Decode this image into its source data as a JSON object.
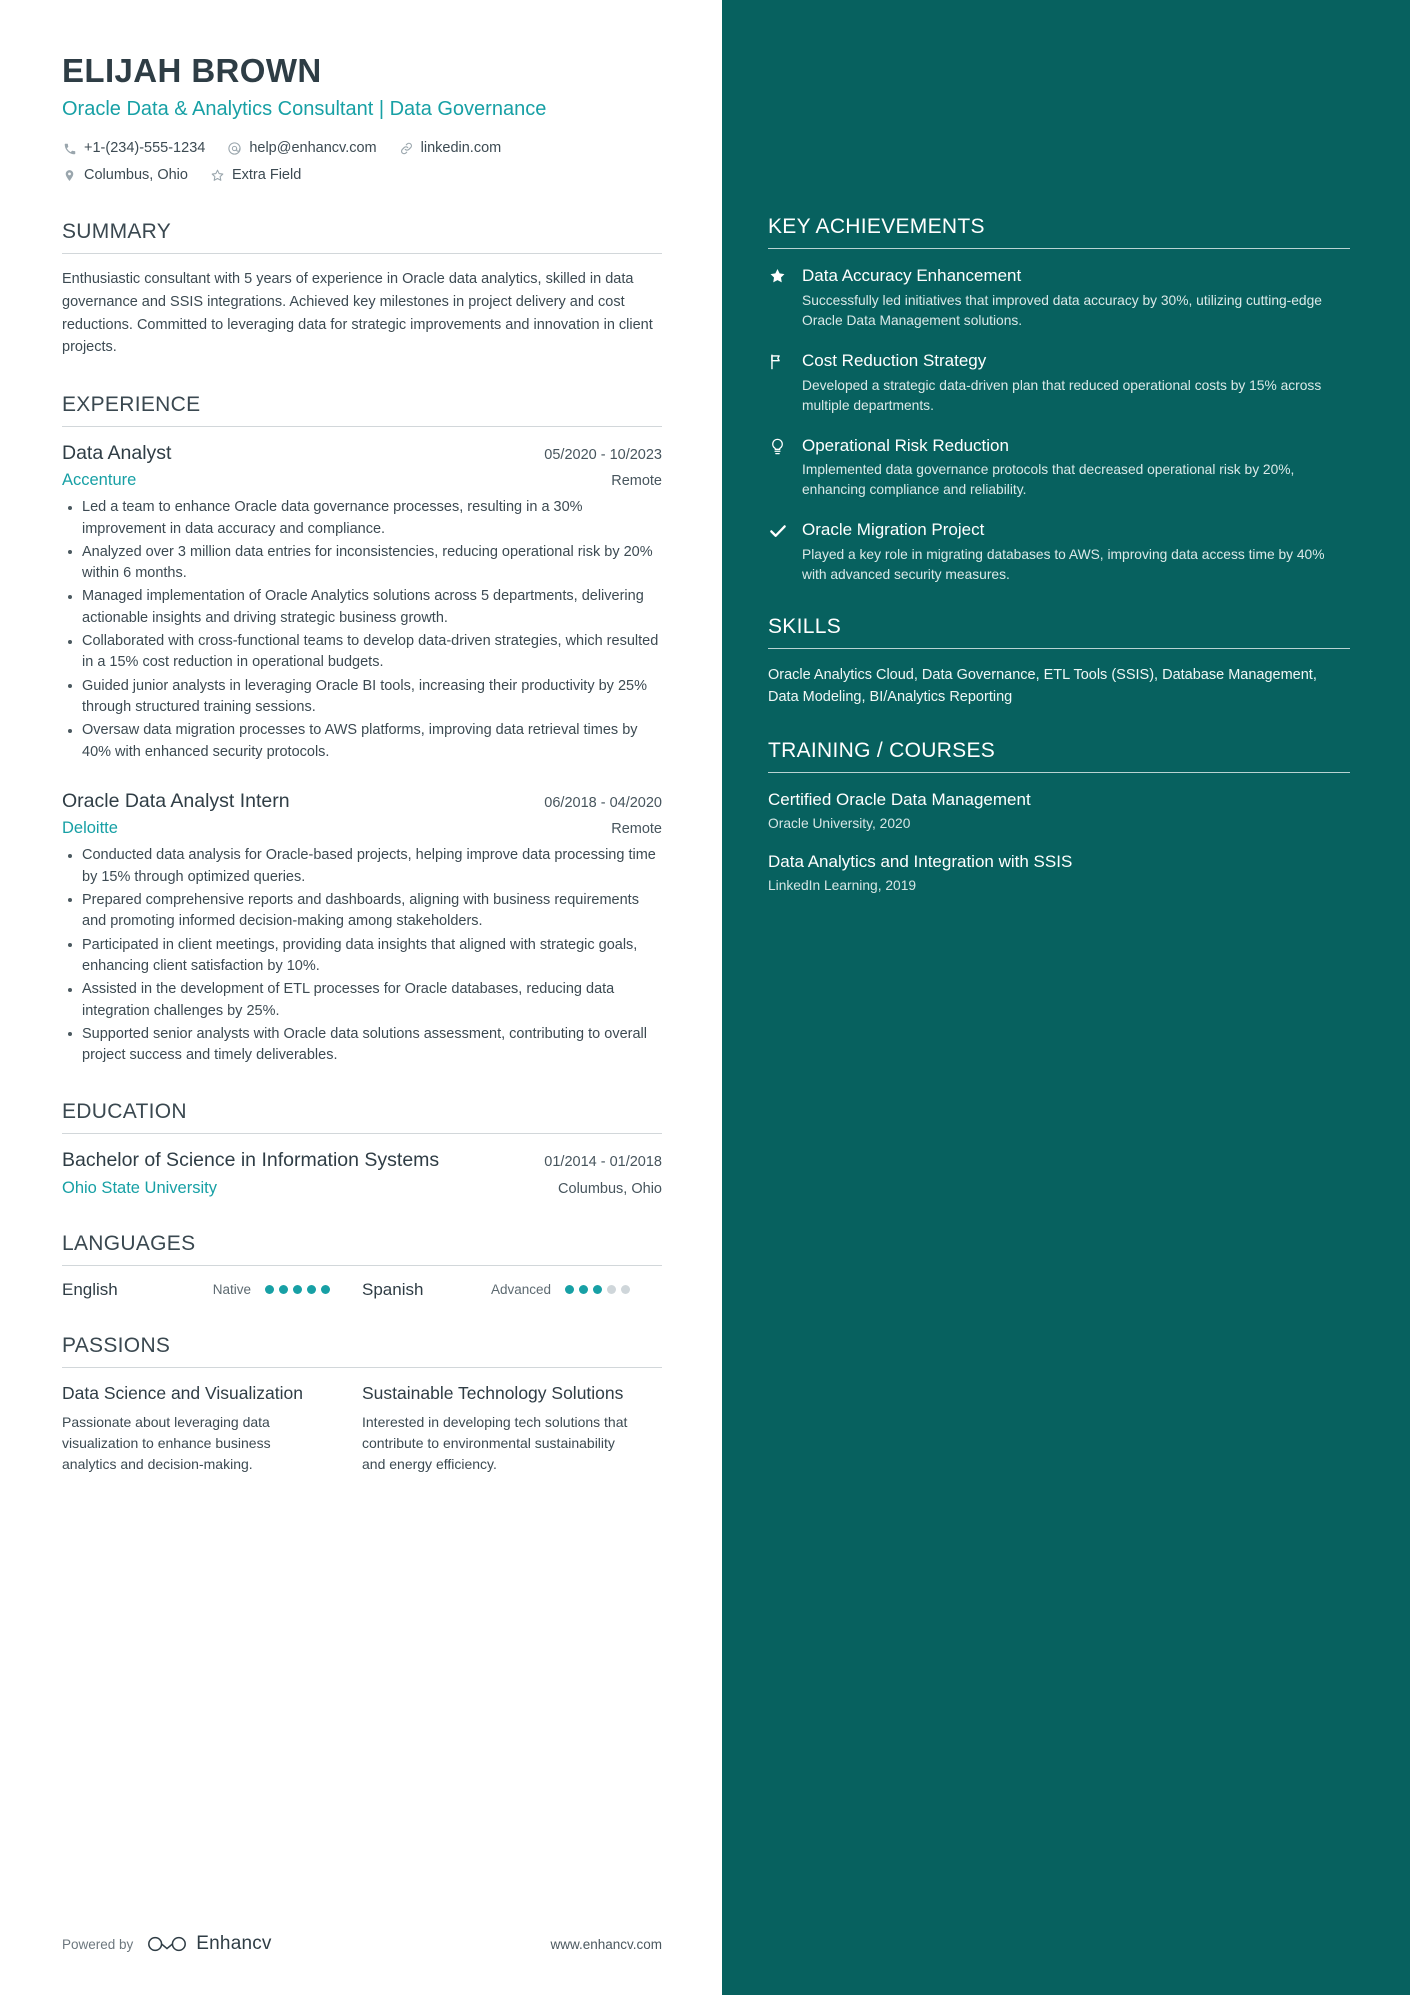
{
  "theme": {
    "accent": "#17a0a5",
    "sidebar_bg": "#07615f",
    "text": "#3c4a52"
  },
  "header": {
    "name": "ELIJAH BROWN",
    "headline": "Oracle Data & Analytics Consultant | Data Governance",
    "contacts_row1": [
      {
        "icon": "phone-icon",
        "text": "+1-(234)-555-1234"
      },
      {
        "icon": "at-email-icon",
        "text": "help@enhancv.com"
      },
      {
        "icon": "link-icon",
        "text": "linkedin.com"
      }
    ],
    "contacts_row2": [
      {
        "icon": "location-pin-icon",
        "text": "Columbus, Ohio"
      },
      {
        "icon": "star-outline-icon",
        "text": "Extra Field"
      }
    ]
  },
  "summary": {
    "title": "SUMMARY",
    "text": "Enthusiastic consultant with 5 years of experience in Oracle data analytics, skilled in data governance and SSIS integrations. Achieved key milestones in project delivery and cost reductions. Committed to leveraging data for strategic improvements and innovation in client projects."
  },
  "experience": {
    "title": "EXPERIENCE",
    "jobs": [
      {
        "title": "Data Analyst",
        "dates": "05/2020 - 10/2023",
        "company": "Accenture",
        "location": "Remote",
        "bullets": [
          "Led a team to enhance Oracle data governance processes, resulting in a 30% improvement in data accuracy and compliance.",
          "Analyzed over 3 million data entries for inconsistencies, reducing operational risk by 20% within 6 months.",
          "Managed implementation of Oracle Analytics solutions across 5 departments, delivering actionable insights and driving strategic business growth.",
          "Collaborated with cross-functional teams to develop data-driven strategies, which resulted in a 15% cost reduction in operational budgets.",
          "Guided junior analysts in leveraging Oracle BI tools, increasing their productivity by 25% through structured training sessions.",
          "Oversaw data migration processes to AWS platforms, improving data retrieval times by 40% with enhanced security protocols."
        ]
      },
      {
        "title": "Oracle Data Analyst Intern",
        "dates": "06/2018 - 04/2020",
        "company": "Deloitte",
        "location": "Remote",
        "bullets": [
          "Conducted data analysis for Oracle-based projects, helping improve data processing time by 15% through optimized queries.",
          "Prepared comprehensive reports and dashboards, aligning with business requirements and promoting informed decision-making among stakeholders.",
          "Participated in client meetings, providing data insights that aligned with strategic goals, enhancing client satisfaction by 10%.",
          "Assisted in the development of ETL processes for Oracle databases, reducing data integration challenges by 25%.",
          "Supported senior analysts with Oracle data solutions assessment, contributing to overall project success and timely deliverables."
        ]
      }
    ]
  },
  "education": {
    "title": "EDUCATION",
    "entries": [
      {
        "degree": "Bachelor of Science in Information Systems",
        "dates": "01/2014 - 01/2018",
        "school": "Ohio State University",
        "location": "Columbus, Ohio"
      }
    ]
  },
  "languages": {
    "title": "LANGUAGES",
    "items": [
      {
        "name": "English",
        "level": "Native",
        "filled": 5,
        "total": 5
      },
      {
        "name": "Spanish",
        "level": "Advanced",
        "filled": 3,
        "total": 5
      }
    ]
  },
  "passions": {
    "title": "PASSIONS",
    "items": [
      {
        "title": "Data Science and Visualization",
        "description": "Passionate about leveraging data visualization to enhance business analytics and decision-making."
      },
      {
        "title": "Sustainable Technology Solutions",
        "description": "Interested in developing tech solutions that contribute to environmental sustainability and energy efficiency."
      }
    ]
  },
  "footer": {
    "powered_by": "Powered by",
    "brand": "Enhancv",
    "url": "www.enhancv.com"
  },
  "key_achievements": {
    "title": "KEY ACHIEVEMENTS",
    "items": [
      {
        "icon": "star-badge-icon",
        "title": "Data Accuracy Enhancement",
        "description": "Successfully led initiatives that improved data accuracy by 30%, utilizing cutting-edge Oracle Data Management solutions."
      },
      {
        "icon": "flag-icon",
        "title": "Cost Reduction Strategy",
        "description": "Developed a strategic data-driven plan that reduced operational costs by 15% across multiple departments."
      },
      {
        "icon": "lightbulb-icon",
        "title": "Operational Risk Reduction",
        "description": "Implemented data governance protocols that decreased operational risk by 20%, enhancing compliance and reliability."
      },
      {
        "icon": "check-icon",
        "title": "Oracle Migration Project",
        "description": "Played a key role in migrating databases to AWS, improving data access time by 40% with advanced security measures."
      }
    ]
  },
  "skills": {
    "title": "SKILLS",
    "text": "Oracle Analytics Cloud, Data Governance, ETL Tools (SSIS), Database Management, Data Modeling, BI/Analytics Reporting"
  },
  "training": {
    "title": "TRAINING / COURSES",
    "items": [
      {
        "title": "Certified Oracle Data Management",
        "meta": "Oracle University, 2020"
      },
      {
        "title": "Data Analytics and Integration with SSIS",
        "meta": "LinkedIn Learning, 2019"
      }
    ]
  }
}
